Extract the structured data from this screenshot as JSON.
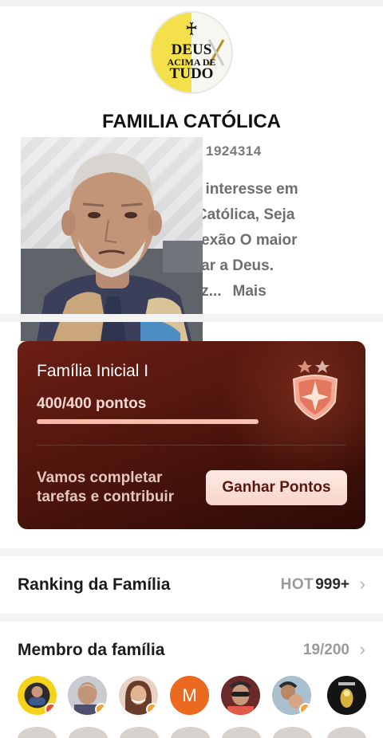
{
  "header": {
    "logo_text_line1": "DEUS",
    "logo_text_line2": "ACIMA DE",
    "logo_text_line3": "TUDO",
    "family_name": "FAMILIA CATÓLICA",
    "family_id": "1924314"
  },
  "description": {
    "lines": [
      "eu interesse em",
      "a Católica, Seja",
      "eflexão O maior",
      "ficar a Deus.",
      "dez..."
    ],
    "more_label": "Mais"
  },
  "level_card": {
    "level_name": "Família Inicial I",
    "points_text": "400/400 pontos",
    "progress_fraction": 1.0,
    "task_text": "Vamos completar tarefas e contribuir",
    "button_label": "Ganhar Pontos",
    "badge_icon": "shield-star-icon",
    "colors": {
      "card_start": "#6c1e14",
      "card_end": "#2d0a06",
      "accent": "#f7b9a8"
    }
  },
  "ranking": {
    "label": "Ranking da Família",
    "hot_label": "HOT",
    "hot_value": "999+"
  },
  "members": {
    "label": "Membro da família",
    "count": "19/200",
    "avatar_letter": "M"
  }
}
